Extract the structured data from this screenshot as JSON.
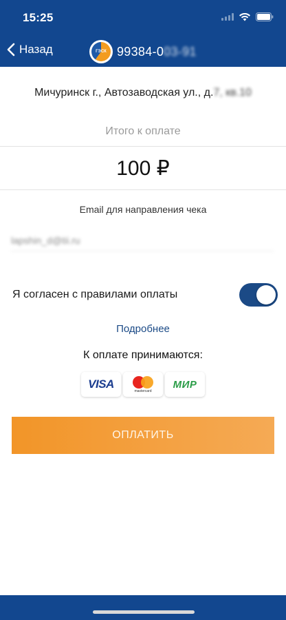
{
  "status_bar": {
    "time": "15:25"
  },
  "nav": {
    "back_label": "Назад",
    "account_prefix": "99384-0",
    "account_hidden": "03-91",
    "logo_text": "ГЭСК"
  },
  "address": {
    "visible": "Мичуринск г., Автозаводская ул., д.",
    "hidden": "7, кв.10"
  },
  "payment": {
    "total_label": "Итого к оплате",
    "amount": "100 ₽"
  },
  "email": {
    "label": "Email для направления чека",
    "value": "lapshin_d@tii.ru"
  },
  "agreement": {
    "text": "Я согласен с правилами оплаты",
    "toggle_on": true,
    "more_link": "Подробнее"
  },
  "accepted": {
    "label": "К оплате принимаются:",
    "cards": [
      "VISA",
      "mastercard",
      "МИР"
    ]
  },
  "pay_button": {
    "label": "ОПЛАТИТЬ"
  },
  "colors": {
    "header": "#12478f",
    "accent_orange": "#f29528",
    "link": "#1b4a86"
  }
}
